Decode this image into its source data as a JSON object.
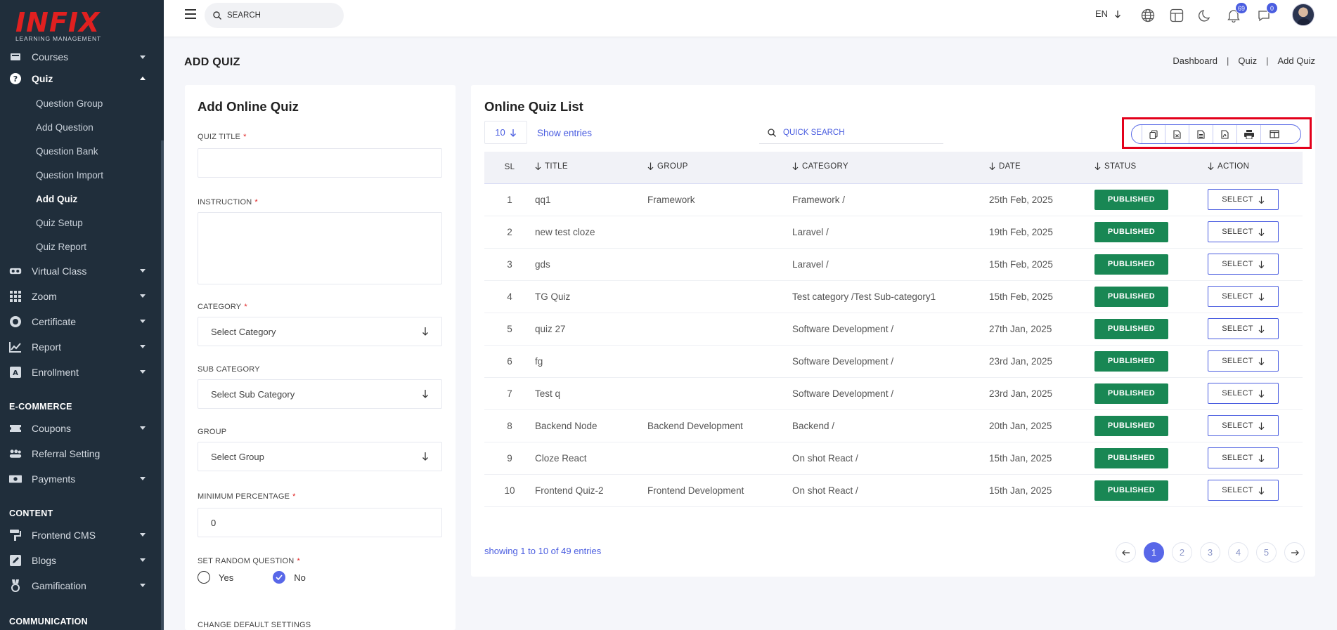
{
  "brand": {
    "name": "INFIX",
    "subtitle": "LEARNING MANAGEMENT",
    "color": "#e02020"
  },
  "sidebar": {
    "items": [
      {
        "label": "Courses",
        "icon": "book-icon"
      },
      {
        "label": "Quiz",
        "icon": "question-icon",
        "expanded": true,
        "children": [
          "Question Group",
          "Add Question",
          "Question Bank",
          "Question Import",
          "Add Quiz",
          "Quiz Setup",
          "Quiz Report"
        ],
        "active_child": "Add Quiz"
      },
      {
        "label": "Virtual Class",
        "icon": "vr-headset-icon"
      },
      {
        "label": "Zoom",
        "icon": "grid-icon"
      },
      {
        "label": "Certificate",
        "icon": "certificate-icon"
      },
      {
        "label": "Report",
        "icon": "chart-icon"
      },
      {
        "label": "Enrollment",
        "icon": "enrollment-icon"
      }
    ],
    "ecommerce_label": "E-COMMERCE",
    "ecommerce": [
      {
        "label": "Coupons",
        "icon": "coupon-icon"
      },
      {
        "label": "Referral Setting",
        "icon": "users-icon"
      },
      {
        "label": "Payments",
        "icon": "payment-icon"
      }
    ],
    "content_label": "CONTENT",
    "content": [
      {
        "label": "Frontend CMS",
        "icon": "paint-roller-icon"
      },
      {
        "label": "Blogs",
        "icon": "blog-icon"
      },
      {
        "label": "Gamification",
        "icon": "medal-icon"
      }
    ],
    "communication_label": "COMMUNICATION"
  },
  "topbar": {
    "search_placeholder": "SEARCH",
    "language": "EN",
    "notifications_count": "69",
    "messages_count": "0"
  },
  "page": {
    "title": "ADD QUIZ",
    "breadcrumb": [
      "Dashboard",
      "Quiz",
      "Add Quiz"
    ]
  },
  "form": {
    "title": "Add Online Quiz",
    "quiz_title_label": "QUIZ TITLE",
    "instruction_label": "INSTRUCTION",
    "category_label": "CATEGORY",
    "category_placeholder": "Select Category",
    "sub_category_label": "SUB CATEGORY",
    "sub_category_placeholder": "Select Sub Category",
    "group_label": "GROUP",
    "group_placeholder": "Select Group",
    "min_percentage_label": "MINIMUM PERCENTAGE",
    "min_percentage_value": "0",
    "random_label": "SET RANDOM QUESTION",
    "random_yes": "Yes",
    "random_no": "No",
    "random_selected": "No",
    "default_settings_label": "CHANGE DEFAULT SETTINGS"
  },
  "list": {
    "title": "Online Quiz List",
    "entries_value": "10",
    "show_entries_label": "Show entries",
    "quick_search_placeholder": "QUICK SEARCH",
    "columns": [
      "SL",
      "TITLE",
      "GROUP",
      "CATEGORY",
      "DATE",
      "STATUS",
      "ACTION"
    ],
    "rows": [
      {
        "sl": "1",
        "title": "qq1",
        "group": "Framework",
        "category": "Framework /",
        "date": "25th Feb, 2025",
        "status": "PUBLISHED",
        "action": "SELECT"
      },
      {
        "sl": "2",
        "title": "new test cloze",
        "group": "",
        "category": "Laravel /",
        "date": "19th Feb, 2025",
        "status": "PUBLISHED",
        "action": "SELECT"
      },
      {
        "sl": "3",
        "title": "gds",
        "group": "",
        "category": "Laravel /",
        "date": "15th Feb, 2025",
        "status": "PUBLISHED",
        "action": "SELECT"
      },
      {
        "sl": "4",
        "title": "TG Quiz",
        "group": "",
        "category": "Test category /Test Sub-category1",
        "date": "15th Feb, 2025",
        "status": "PUBLISHED",
        "action": "SELECT"
      },
      {
        "sl": "5",
        "title": "quiz 27",
        "group": "",
        "category": "Software Development /",
        "date": "27th Jan, 2025",
        "status": "PUBLISHED",
        "action": "SELECT"
      },
      {
        "sl": "6",
        "title": "fg",
        "group": "",
        "category": "Software Development /",
        "date": "23rd Jan, 2025",
        "status": "PUBLISHED",
        "action": "SELECT"
      },
      {
        "sl": "7",
        "title": "Test q",
        "group": "",
        "category": "Software Development /",
        "date": "23rd Jan, 2025",
        "status": "PUBLISHED",
        "action": "SELECT"
      },
      {
        "sl": "8",
        "title": "Backend Node",
        "group": "Backend Development",
        "category": "Backend /",
        "date": "20th Jan, 2025",
        "status": "PUBLISHED",
        "action": "SELECT"
      },
      {
        "sl": "9",
        "title": "Cloze React",
        "group": "",
        "category": "On shot React /",
        "date": "15th Jan, 2025",
        "status": "PUBLISHED",
        "action": "SELECT"
      },
      {
        "sl": "10",
        "title": "Frontend Quiz-2",
        "group": "Frontend Development",
        "category": "On shot React /",
        "date": "15th Jan, 2025",
        "status": "PUBLISHED",
        "action": "SELECT"
      }
    ],
    "showing": "showing 1 to 10 of 49 entries",
    "pages": [
      "1",
      "2",
      "3",
      "4",
      "5"
    ],
    "current_page": "1",
    "export_buttons": [
      "copy-icon",
      "csv-icon",
      "excel-icon",
      "pdf-icon",
      "print-icon",
      "columns-icon"
    ]
  },
  "colors": {
    "sidebar_bg": "#202e3b",
    "accent": "#4a5de0",
    "published": "#198754",
    "highlight": "#e3001b"
  }
}
